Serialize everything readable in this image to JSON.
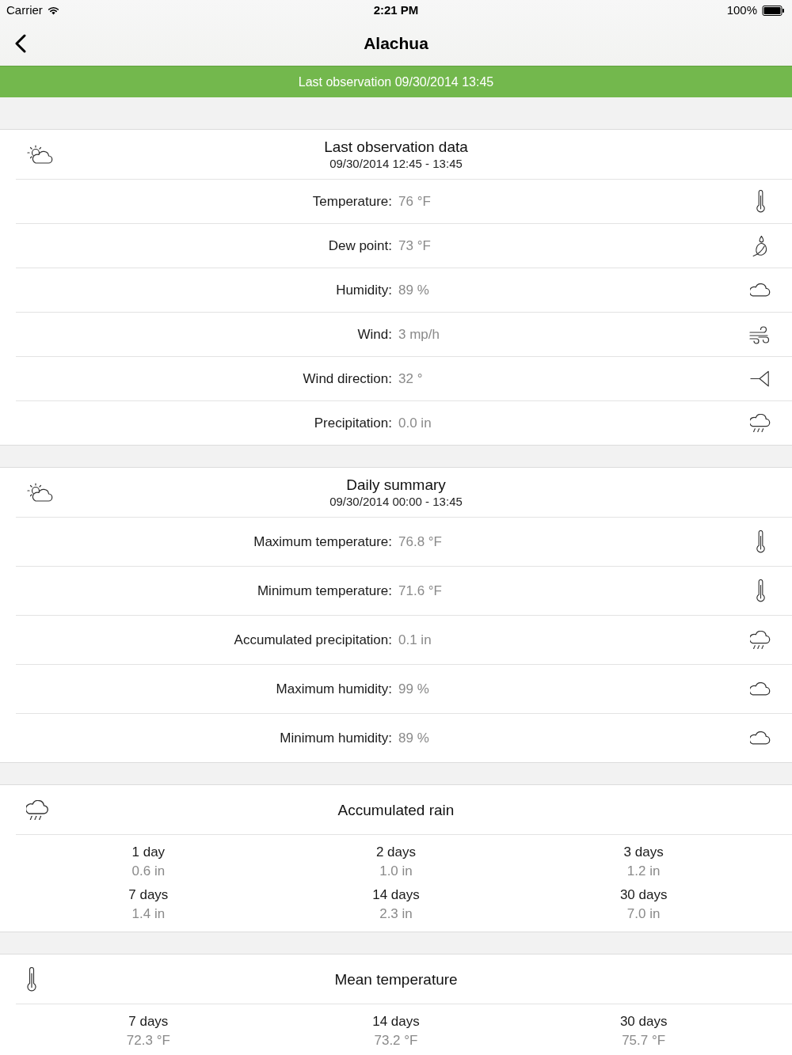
{
  "status_bar": {
    "carrier": "Carrier",
    "time": "2:21 PM",
    "battery": "100%"
  },
  "nav_bar": {
    "title": "Alachua"
  },
  "banner": {
    "text": "Last observation 09/30/2014 13:45"
  },
  "sections": [
    {
      "kind": "list",
      "title": "Last observation data",
      "subtitle": "09/30/2014 12:45 - 13:45",
      "rows": [
        {
          "kind": "temperature",
          "label": "Temperature:",
          "value": "76 °F"
        },
        {
          "kind": "dew_point",
          "label": "Dew point:",
          "value": "73 °F"
        },
        {
          "kind": "humidity",
          "label": "Humidity:",
          "value": "89 %"
        },
        {
          "kind": "wind",
          "label": "Wind:",
          "value": "3 mp/h"
        },
        {
          "kind": "wind_direction",
          "label": "Wind direction:",
          "value": "32 °"
        },
        {
          "kind": "precipitation",
          "label": "Precipitation:",
          "value": "0.0 in"
        }
      ]
    },
    {
      "kind": "list",
      "title": "Daily summary",
      "subtitle": "09/30/2014 00:00 - 13:45",
      "rows": [
        {
          "kind": "temperature",
          "label": "Maximum temperature:",
          "value": "76.8 °F"
        },
        {
          "kind": "temperature",
          "label": "Minimum temperature:",
          "value": "71.6 °F"
        },
        {
          "kind": "precipitation",
          "label": "Accumulated precipitation:",
          "value": "0.1 in"
        },
        {
          "kind": "humidity",
          "label": "Maximum humidity:",
          "value": "99 %"
        },
        {
          "kind": "humidity",
          "label": "Minimum humidity:",
          "value": "89 %"
        }
      ]
    },
    {
      "kind": "grid",
      "title": "Accumulated rain",
      "cells": [
        {
          "label": "1 day",
          "value": "0.6 in"
        },
        {
          "label": "2 days",
          "value": "1.0 in"
        },
        {
          "label": "3 days",
          "value": "1.2 in"
        },
        {
          "label": "7 days",
          "value": "1.4 in"
        },
        {
          "label": "14 days",
          "value": "2.3 in"
        },
        {
          "label": "30 days",
          "value": "7.0 in"
        }
      ]
    },
    {
      "kind": "grid",
      "title": "Mean temperature",
      "cells": [
        {
          "label": "7 days",
          "value": "72.3 °F"
        },
        {
          "label": "14 days",
          "value": "73.2 °F"
        },
        {
          "label": "30 days",
          "value": "75.7 °F"
        }
      ]
    }
  ]
}
